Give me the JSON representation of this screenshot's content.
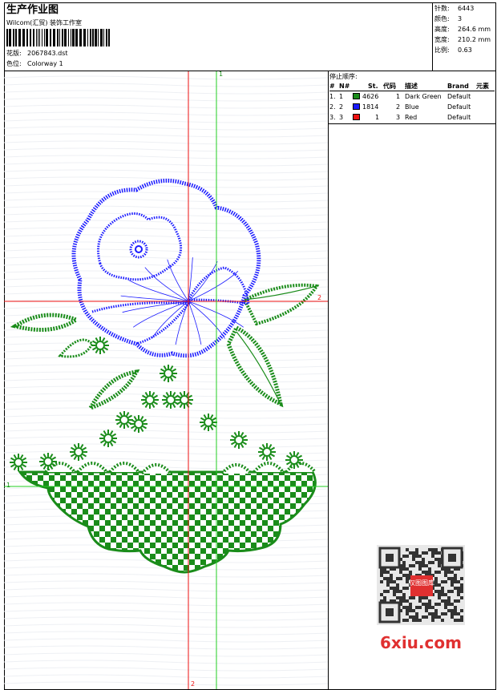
{
  "header": {
    "title": "生产作业图",
    "company": "Wilcom(汇贸) 装饰工作室",
    "design_label": "花版:",
    "design_file": "2067843.dst",
    "colorway_label": "色位:",
    "colorway": "Colorway 1"
  },
  "stats": [
    {
      "label": "针数:",
      "value": "6443"
    },
    {
      "label": "颜色:",
      "value": "3"
    },
    {
      "label": "高度:",
      "value": "264.6 mm"
    },
    {
      "label": "宽度:",
      "value": "210.2 mm"
    },
    {
      "label": "比例:",
      "value": "0.63"
    }
  ],
  "stop_sequence": {
    "title": "停止顺序:",
    "columns": [
      "#",
      "N#",
      "St.",
      "代码",
      "描述",
      "Brand",
      "元素"
    ],
    "rows": [
      {
        "num": "1.",
        "n": "1",
        "color": "#1a8c1a",
        "stitches": "4626",
        "code": "1",
        "desc": "Dark Green",
        "brand": "Default"
      },
      {
        "num": "2.",
        "n": "2",
        "color": "#1a1aff",
        "stitches": "1814",
        "code": "2",
        "desc": "Blue",
        "brand": "Default"
      },
      {
        "num": "3.",
        "n": "3",
        "color": "#ee1111",
        "stitches": "1",
        "code": "3",
        "desc": "Red",
        "brand": "Default"
      }
    ]
  },
  "rulers": {
    "green_top": "1",
    "red_right": "2",
    "green_left": "1",
    "red_bottom": "2"
  },
  "colors": {
    "green_thread": "#1a8c1a",
    "blue_thread": "#1a1aff",
    "red_guide": "#ee1111",
    "green_guide": "#22cc22"
  },
  "watermark": {
    "site": "6xiu.com",
    "stamp": "汉图图库"
  }
}
